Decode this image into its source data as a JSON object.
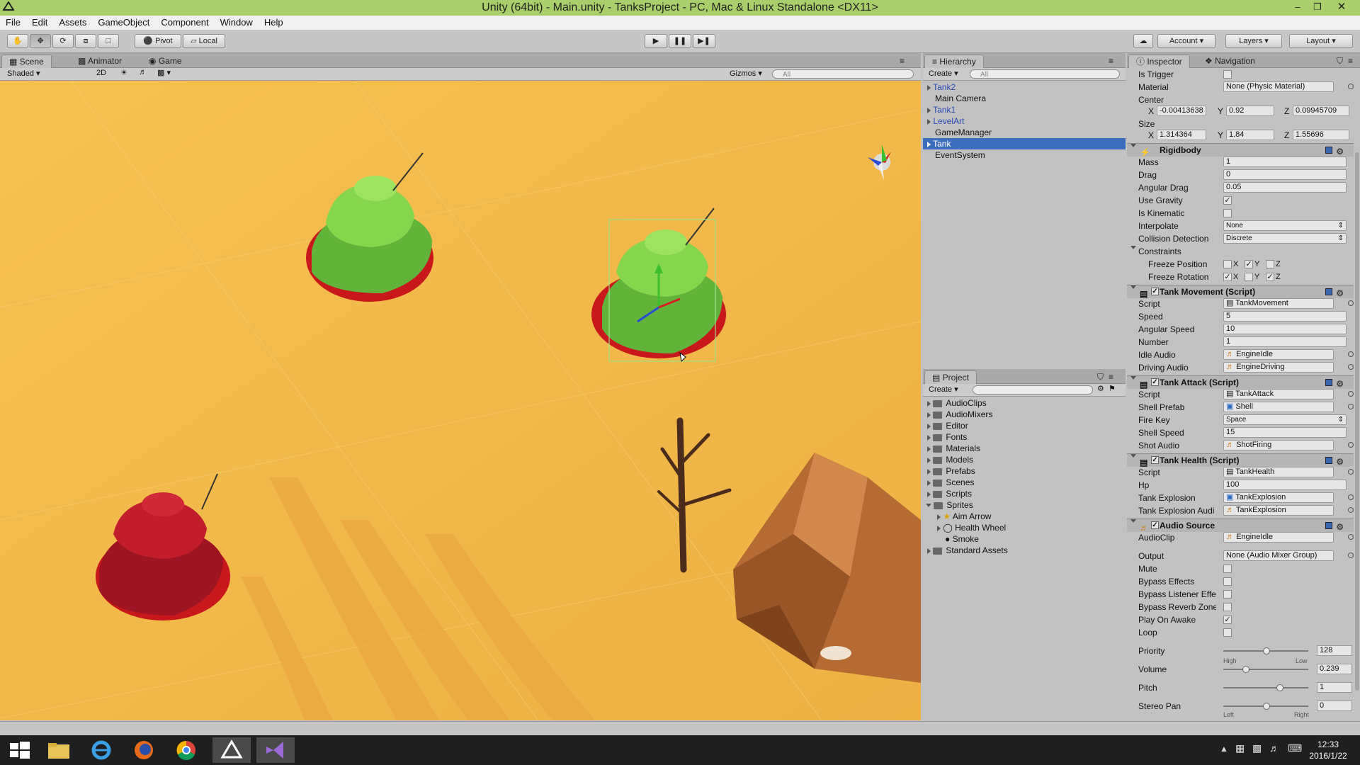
{
  "window": {
    "title": "Unity (64bit) - Main.unity - TanksProject - PC, Mac & Linux Standalone <DX11>"
  },
  "menu": [
    "File",
    "Edit",
    "Assets",
    "GameObject",
    "Component",
    "Window",
    "Help"
  ],
  "toolbar": {
    "pivot": "Pivot",
    "local": "Local",
    "account": "Account",
    "layers": "Layers",
    "layout": "Layout"
  },
  "scene": {
    "tabs": [
      "Scene",
      "Animator",
      "Game"
    ],
    "shading": "Shaded",
    "mode2d": "2D",
    "gizmos": "Gizmos",
    "search_placeholder": "All",
    "colors": {
      "ground": "#f3b94a",
      "tank_green": "#7fd04a",
      "tank_red": "#c01d2a",
      "ring": "#cc1010",
      "rock": "#b86a33"
    }
  },
  "hierarchy": {
    "tab": "Hierarchy",
    "create": "Create",
    "search_placeholder": "All",
    "items": [
      "Tank2",
      "Main Camera",
      "Tank1",
      "LevelArt",
      "GameManager",
      "Tank",
      "EventSystem"
    ]
  },
  "project": {
    "tab": "Project",
    "create": "Create",
    "folders": [
      "AudioClips",
      "AudioMixers",
      "Editor",
      "Fonts",
      "Materials",
      "Models",
      "Prefabs",
      "Scenes",
      "Scripts",
      "Sprites"
    ],
    "sprites": [
      "Aim Arrow",
      "Health Wheel",
      "Smoke"
    ],
    "last": "Standard Assets"
  },
  "inspector": {
    "tabs": [
      "Inspector",
      "Navigation"
    ],
    "collider": {
      "is_trigger": "Is Trigger",
      "material_label": "Material",
      "material_value": "None (Physic Material)",
      "center_label": "Center",
      "center": {
        "x": "-0.00413638",
        "y": "0.92",
        "z": "0.09945709"
      },
      "size_label": "Size",
      "size": {
        "x": "1.314364",
        "y": "1.84",
        "z": "1.55696"
      }
    },
    "rigidbody": {
      "title": "Rigidbody",
      "mass_label": "Mass",
      "mass": "1",
      "drag_label": "Drag",
      "drag": "0",
      "angular_drag_label": "Angular Drag",
      "angular_drag": "0.05",
      "use_gravity": "Use Gravity",
      "is_kinematic": "Is Kinematic",
      "interpolate_label": "Interpolate",
      "interpolate": "None",
      "collision_label": "Collision Detection",
      "collision": "Discrete",
      "constraints": "Constraints",
      "freeze_position": "Freeze Position",
      "freeze_rotation": "Freeze Rotation"
    },
    "tank_movement": {
      "title": "Tank Movement (Script)",
      "script_label": "Script",
      "script": "TankMovement",
      "speed_label": "Speed",
      "speed": "5",
      "angular_speed_label": "Angular Speed",
      "angular_speed": "10",
      "number_label": "Number",
      "number": "1",
      "idle_audio_label": "Idle Audio",
      "idle_audio": "EngineIdle",
      "driving_audio_label": "Driving Audio",
      "driving_audio": "EngineDriving"
    },
    "tank_attack": {
      "title": "Tank Attack (Script)",
      "script_label": "Script",
      "script": "TankAttack",
      "shell_prefab_label": "Shell Prefab",
      "shell_prefab": "Shell",
      "fire_key_label": "Fire Key",
      "fire_key": "Space",
      "shell_speed_label": "Shell Speed",
      "shell_speed": "15",
      "shot_audio_label": "Shot Audio",
      "shot_audio": "ShotFiring"
    },
    "tank_health": {
      "title": "Tank Health (Script)",
      "script_label": "Script",
      "script": "TankHealth",
      "hp_label": "Hp",
      "hp": "100",
      "explosion_label": "Tank Explosion",
      "explosion": "TankExplosion",
      "explosion_audio_label": "Tank Explosion Audi",
      "explosion_audio": "TankExplosion"
    },
    "audio_source": {
      "title": "Audio Source",
      "clip_label": "AudioClip",
      "clip": "EngineIdle",
      "output_label": "Output",
      "output": "None (Audio Mixer Group)",
      "mute": "Mute",
      "bypass_effects": "Bypass Effects",
      "bypass_listener": "Bypass Listener Effe",
      "bypass_reverb": "Bypass Reverb Zone",
      "play_on_awake": "Play On Awake",
      "loop": "Loop",
      "priority_label": "Priority",
      "priority": "128",
      "priority_level": 0.5,
      "high": "High",
      "low": "Low",
      "volume_label": "Volume",
      "volume": "0.239",
      "volume_level": 0.239,
      "pitch_label": "Pitch",
      "pitch": "1",
      "pitch_level": 0.67,
      "stereo_label": "Stereo Pan",
      "stereo": "0",
      "stereo_level": 0.5,
      "left": "Left",
      "right": "Right"
    }
  },
  "taskbar": {
    "time": "12:33",
    "date": "2016/1/22"
  }
}
